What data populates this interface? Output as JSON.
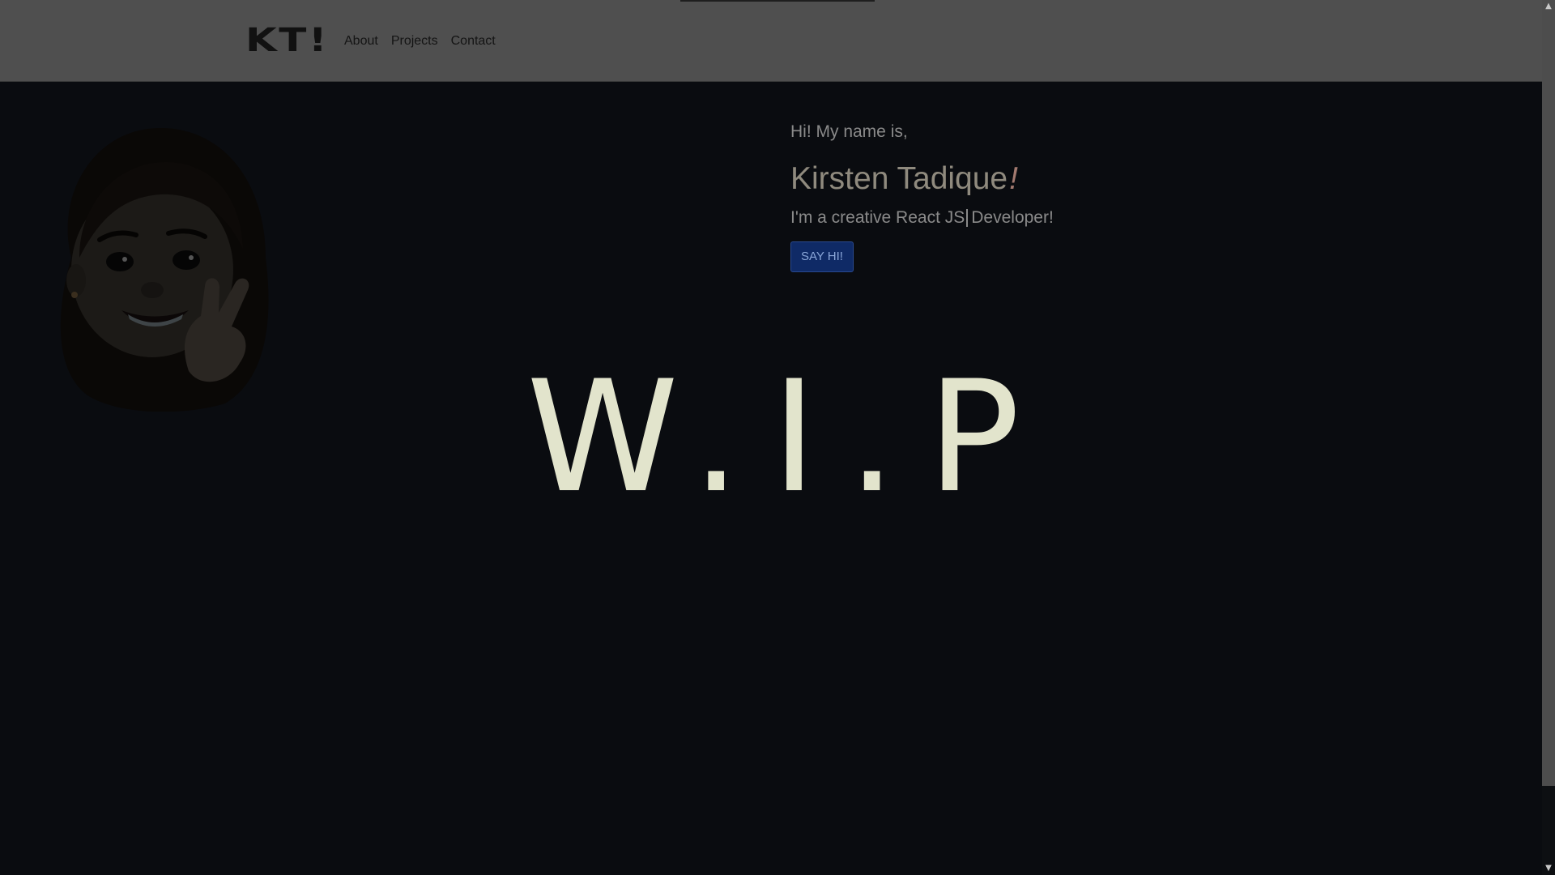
{
  "navbar": {
    "brand": "KT!",
    "links": [
      "About",
      "Projects",
      "Contact"
    ]
  },
  "hero": {
    "greeting": "Hi! My name is,",
    "name": "Kirsten Tadique",
    "name_suffix": "!",
    "tagline_prefix": "I'm a creative React JS",
    "tagline_suffix": "Developer!",
    "button_label": "SAY HI!"
  },
  "wip_text": "W.I.P",
  "icons": {
    "avatar": "memoji-avatar-peace-sign",
    "scroll_up": "chevron-up-icon",
    "scroll_down": "chevron-down-icon"
  },
  "colors": {
    "background": "#0a0c10",
    "navbar": "#4f4f4f",
    "wip_text": "#e2e4cc",
    "button": "#0f2a66"
  }
}
